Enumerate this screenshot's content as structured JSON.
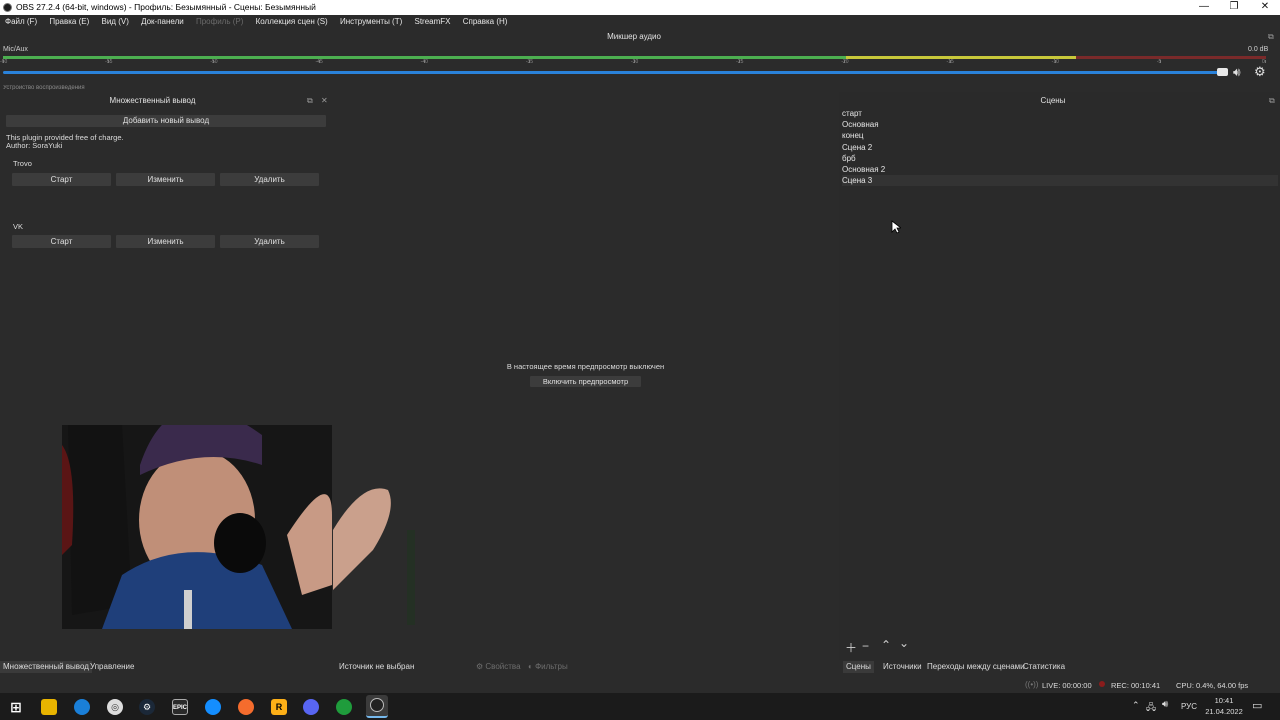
{
  "window": {
    "title": "OBS 27.2.4 (64-bit, windows) - Профиль: Безымянный - Сцены: Безымянный",
    "minimize": "—",
    "restore": "❐",
    "close": "✕"
  },
  "menu": [
    {
      "label": "Файл (F)",
      "enabled": true
    },
    {
      "label": "Правка (E)",
      "enabled": true
    },
    {
      "label": "Вид (V)",
      "enabled": true
    },
    {
      "label": "Док-панели",
      "enabled": true
    },
    {
      "label": "Профиль (P)",
      "enabled": false
    },
    {
      "label": "Коллекция сцен (S)",
      "enabled": true
    },
    {
      "label": "Инструменты (T)",
      "enabled": true
    },
    {
      "label": "StreamFX",
      "enabled": true
    },
    {
      "label": "Справка (H)",
      "enabled": true
    }
  ],
  "mixer": {
    "title": "Микшер аудио",
    "channel": "Mic/Aux",
    "db": "0.0 dB",
    "ticks": [
      "-60",
      "-55",
      "-50",
      "-45",
      "-40",
      "-35",
      "-30",
      "-25",
      "-20",
      "-15",
      "-10",
      "-5",
      "0"
    ],
    "next_channel": "Устройство воспроизведения",
    "colors": {
      "green": "#4caf50",
      "yellow": "#c8c83a",
      "red": "#a53030",
      "fader": "#2a82da"
    }
  },
  "multi_output": {
    "title": "Множественный вывод",
    "add_button": "Добавить новый вывод",
    "info_line1": "This plugin provided free of charge.",
    "info_line2": "Author: SoraYuki",
    "outputs": [
      {
        "name": "Trovo",
        "start": "Старт",
        "edit": "Изменить",
        "delete": "Удалить"
      },
      {
        "name": "VK",
        "start": "Старт",
        "edit": "Изменить",
        "delete": "Удалить"
      }
    ]
  },
  "preview": {
    "disabled_text": "В настоящее время предпросмотр выключен",
    "enable_button": "Включить предпросмотр"
  },
  "scenes": {
    "title": "Сцены",
    "items": [
      "старт",
      "Основная",
      "конец",
      "Сцена 2",
      "брб",
      "Основная 2",
      "Сцена 3"
    ],
    "selected_index": 6
  },
  "left_tabs": [
    "Множественный вывод",
    "Управление"
  ],
  "source_bar": {
    "no_source": "Источник не выбран",
    "properties": "Свойства",
    "filters": "Фильтры"
  },
  "right_tabs": [
    "Сцены",
    "Источники",
    "Переходы между сценами",
    "Статистика"
  ],
  "status": {
    "live": "LIVE: 00:00:00",
    "rec": "REC: 00:10:41",
    "cpu": "CPU: 0.4%, 64.00 fps"
  },
  "taskbar": {
    "lang": "РУС",
    "time": "10:41",
    "date": "21.04.2022",
    "apps": [
      {
        "name": "start-icon",
        "glyph": ""
      },
      {
        "name": "file-explorer-icon",
        "glyph": ""
      },
      {
        "name": "edge-icon",
        "glyph": ""
      },
      {
        "name": "chrome-icon",
        "glyph": ""
      },
      {
        "name": "steam-icon",
        "glyph": ""
      },
      {
        "name": "epic-games-icon",
        "glyph": "EPIC"
      },
      {
        "name": "battlenet-icon",
        "glyph": ""
      },
      {
        "name": "origin-icon",
        "glyph": ""
      },
      {
        "name": "rockstar-icon",
        "glyph": "R"
      },
      {
        "name": "discord-icon",
        "glyph": ""
      },
      {
        "name": "utorrent-icon",
        "glyph": ""
      },
      {
        "name": "obs-icon",
        "glyph": ""
      }
    ]
  }
}
